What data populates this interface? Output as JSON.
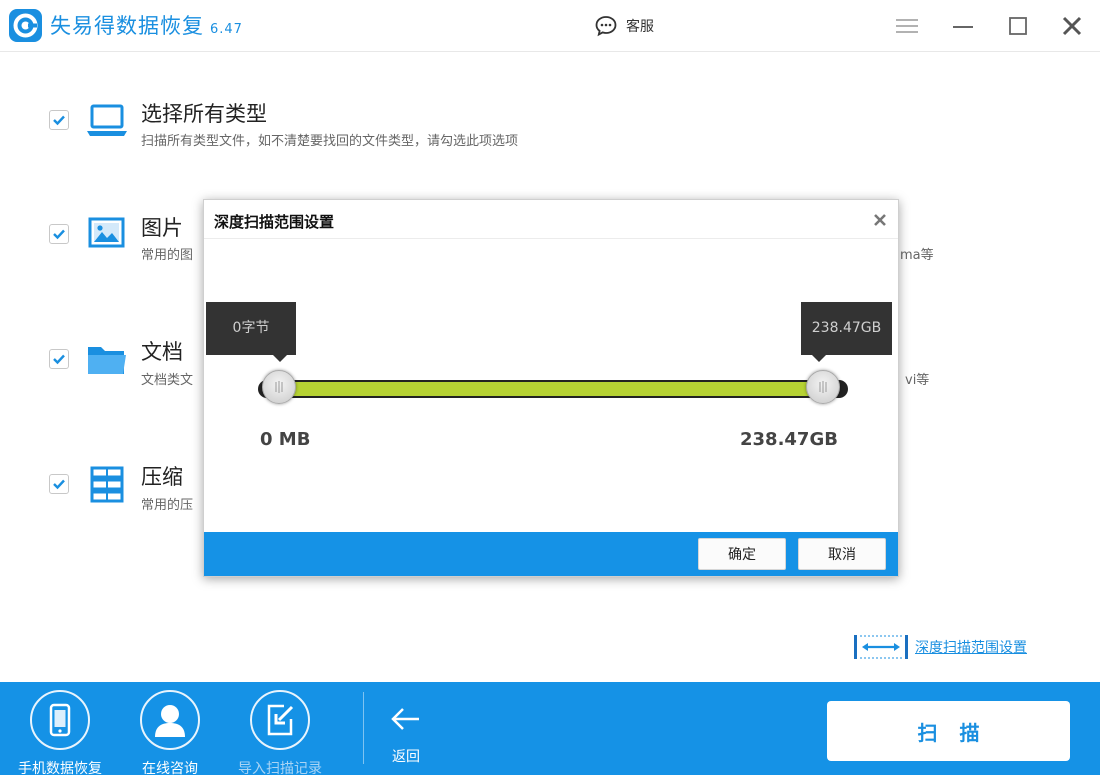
{
  "titlebar": {
    "app_name": "失易得数据恢复",
    "version": "6.47",
    "support_label": "客服"
  },
  "categories": [
    {
      "title": "选择所有类型",
      "desc": "扫描所有类型文件，如不清楚要找回的文件类型，请勾选此项选项",
      "desc_tail": "",
      "checked": true,
      "icon": "laptop-icon"
    },
    {
      "title": "图片",
      "desc": "常用的图",
      "desc_tail": "ma等",
      "checked": true,
      "icon": "image-icon"
    },
    {
      "title": "文档",
      "desc": "文档类文",
      "desc_tail": "vi等",
      "checked": true,
      "icon": "folder-icon"
    },
    {
      "title": "压缩",
      "desc": "常用的压",
      "desc_tail": "",
      "checked": true,
      "icon": "archive-icon"
    }
  ],
  "deep_scan_link": "深度扫描范围设置",
  "bottombar": {
    "items": [
      {
        "label": "手机数据恢复",
        "icon": "phone-icon"
      },
      {
        "label": "在线咨询",
        "icon": "user-icon"
      },
      {
        "label": "导入扫描记录",
        "icon": "import-icon"
      }
    ],
    "back_label": "返回",
    "scan_label": "扫描"
  },
  "dialog": {
    "title": "深度扫描范围设置",
    "tooltip_min": "0字节",
    "tooltip_max": "238.47GB",
    "min_label": "0 MB",
    "max_label": "238.47GB",
    "range_start_fraction": 0,
    "range_end_fraction": 1,
    "ok_label": "确定",
    "cancel_label": "取消"
  },
  "colors": {
    "accent": "#1592e6",
    "range_fill": "#b6d233",
    "tooltip_bg": "#333333"
  }
}
